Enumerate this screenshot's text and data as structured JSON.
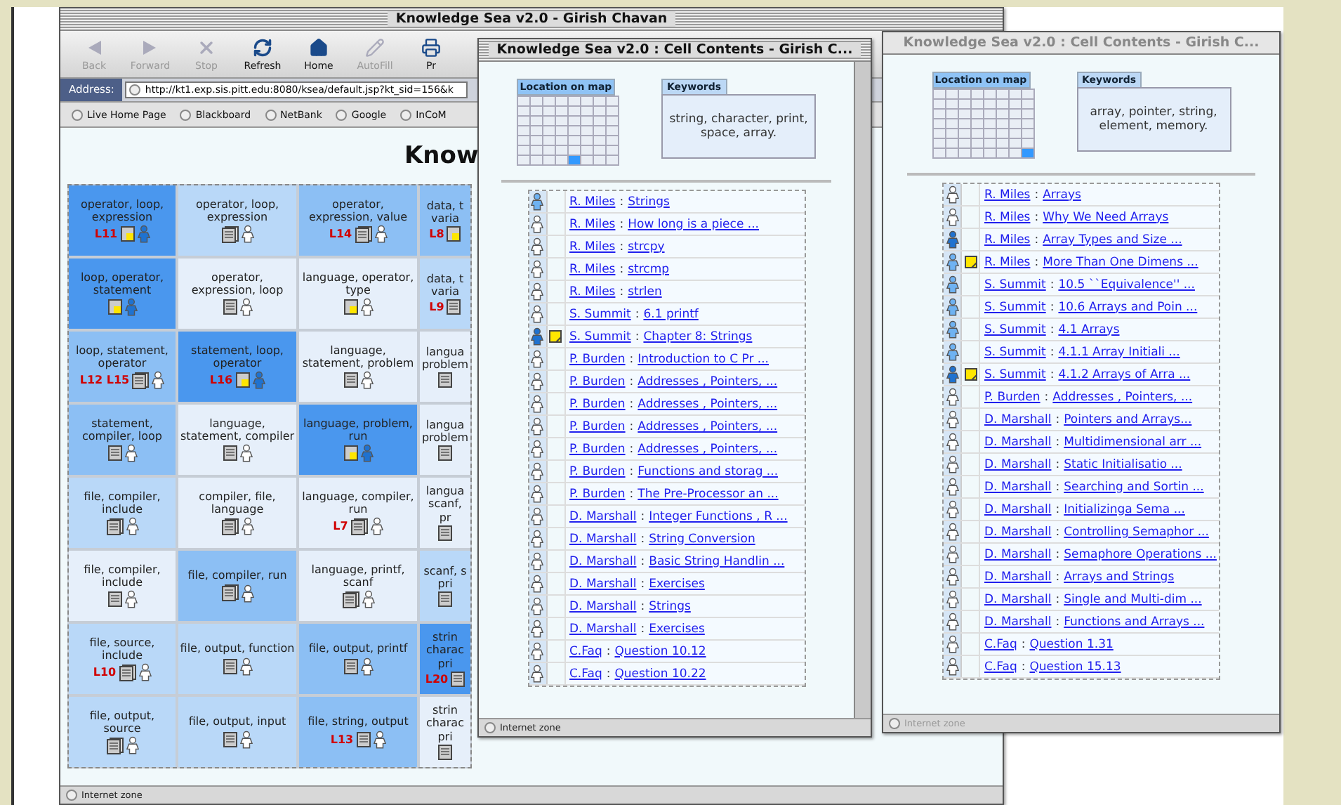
{
  "browser": {
    "title": "Knowledge Sea v2.0 - Girish Chavan",
    "toolbar": [
      {
        "label": "Back",
        "kind": "back",
        "disabled": true
      },
      {
        "label": "Forward",
        "kind": "forward",
        "disabled": true
      },
      {
        "label": "Stop",
        "kind": "stop",
        "disabled": true
      },
      {
        "label": "Refresh",
        "kind": "refresh",
        "disabled": false
      },
      {
        "label": "Home",
        "kind": "home",
        "disabled": false
      },
      {
        "label": "AutoFill",
        "kind": "autofill",
        "disabled": true
      },
      {
        "label": "Pr",
        "kind": "print",
        "disabled": false
      }
    ],
    "address_label": "Address:",
    "url": "http://kt1.exp.sis.pitt.edu:8080/ksea/default.jsp?kt_sid=156&k",
    "favorites": [
      "Live Home Page",
      "Blackboard",
      "NetBank",
      "Google",
      "InCoM"
    ],
    "heading": "Know",
    "grid": [
      [
        {
          "keywords": "operator, loop, expression",
          "labels": [
            "L11"
          ],
          "kind": "note",
          "filled": true,
          "color": "#4a97ee"
        },
        {
          "keywords": "operator, loop, expression",
          "kind": "docs",
          "filled": false,
          "color": "#b9d8f8"
        },
        {
          "keywords": "operator, expression, value",
          "labels": [
            "L14"
          ],
          "kind": "docs",
          "filled": false,
          "color": "#8cbff4"
        },
        {
          "keywords": "data, t varia",
          "labels": [
            "L8"
          ],
          "kind": "note",
          "color": "#8cbff4"
        }
      ],
      [
        {
          "keywords": "loop, operator, statement",
          "kind": "note",
          "filled": true,
          "color": "#4a97ee"
        },
        {
          "keywords": "operator, expression, loop",
          "kind": "doc",
          "filled": false,
          "color": "#e6effa"
        },
        {
          "keywords": "language, operator, type",
          "kind": "note",
          "filled": false,
          "color": "#e6effa"
        },
        {
          "keywords": "data, t varia",
          "labels": [
            "L9"
          ],
          "kind": "doc",
          "color": "#b9d8f8"
        }
      ],
      [
        {
          "keywords": "loop, statement, operator",
          "labels": [
            "L12",
            "L15"
          ],
          "kind": "docs",
          "filled": false,
          "color": "#8cbff4"
        },
        {
          "keywords": "statement, loop, operator",
          "labels": [
            "L16"
          ],
          "kind": "note",
          "filled": true,
          "color": "#4a97ee"
        },
        {
          "keywords": "language, statement, problem",
          "kind": "doc",
          "filled": false,
          "color": "#e6effa"
        },
        {
          "keywords": "langua problem",
          "kind": "doc",
          "color": "#e6effa"
        }
      ],
      [
        {
          "keywords": "statement, compiler, loop",
          "kind": "doc",
          "filled": false,
          "color": "#8cbff4"
        },
        {
          "keywords": "language, statement, compiler",
          "kind": "doc",
          "filled": false,
          "color": "#e6effa"
        },
        {
          "keywords": "language, problem, run",
          "kind": "note",
          "filled": true,
          "color": "#4a97ee"
        },
        {
          "keywords": "langua problem",
          "kind": "doc",
          "color": "#e6effa"
        }
      ],
      [
        {
          "keywords": "file, compiler, include",
          "kind": "docs",
          "filled": false,
          "color": "#b9d8f8"
        },
        {
          "keywords": "compiler, file, language",
          "kind": "docs",
          "filled": false,
          "color": "#e6effa"
        },
        {
          "keywords": "language, compiler, run",
          "labels": [
            "L7"
          ],
          "kind": "docs",
          "filled": false,
          "color": "#e6effa"
        },
        {
          "keywords": "langua scanf, pr",
          "kind": "doc",
          "color": "#e6effa"
        }
      ],
      [
        {
          "keywords": "file, compiler, include",
          "kind": "doc",
          "filled": false,
          "color": "#e6effa"
        },
        {
          "keywords": "file, compiler, run",
          "kind": "docs",
          "filled": false,
          "color": "#8cbff4"
        },
        {
          "keywords": "language, printf, scanf",
          "kind": "docs",
          "filled": false,
          "color": "#e6effa"
        },
        {
          "keywords": "scanf, s pri",
          "kind": "doc",
          "color": "#b9d8f8"
        }
      ],
      [
        {
          "keywords": "file, source, include",
          "labels": [
            "L10"
          ],
          "kind": "docs",
          "filled": false,
          "color": "#b9d8f8"
        },
        {
          "keywords": "file, output, function",
          "kind": "doc",
          "filled": false,
          "color": "#b9d8f8"
        },
        {
          "keywords": "file, output, printf",
          "kind": "doc",
          "filled": false,
          "color": "#8cbff4"
        },
        {
          "keywords": "strin charac pri",
          "labels": [
            "L20"
          ],
          "kind": "doc",
          "color": "#4a97ee"
        }
      ],
      [
        {
          "keywords": "file, output, source",
          "kind": "docs",
          "filled": false,
          "color": "#b9d8f8"
        },
        {
          "keywords": "file, output, input",
          "kind": "doc",
          "filled": false,
          "color": "#b9d8f8"
        },
        {
          "keywords": "file, string, output",
          "labels": [
            "L13"
          ],
          "kind": "doc",
          "filled": false,
          "color": "#8cbff4"
        },
        {
          "keywords": "strin charac pri",
          "kind": "doc",
          "color": "#e6effa"
        }
      ]
    ],
    "status": "Internet zone"
  },
  "windows": [
    {
      "title": "Knowledge Sea v2.0 : Cell Contents - Girish C...",
      "active": true,
      "location_label": "Location on map",
      "keywords_label": "Keywords",
      "keywords": "string, character, print, space, array.",
      "map_rows": [
        [
          false,
          false,
          false,
          false,
          false,
          false,
          false,
          false
        ],
        [
          false,
          false,
          false,
          false,
          false,
          false,
          false,
          false
        ],
        [
          false,
          false,
          false,
          false,
          false,
          false,
          false,
          false
        ],
        [
          false,
          false,
          false,
          false,
          false,
          false,
          false,
          false
        ],
        [
          false,
          false,
          false,
          false,
          false,
          false,
          false,
          false
        ],
        [
          false,
          false,
          false,
          false,
          false,
          false,
          false,
          false
        ],
        [
          false,
          false,
          false,
          false,
          true,
          false,
          false,
          false
        ]
      ],
      "items": [
        {
          "color": "#6eb2f2",
          "note": false,
          "author": "R. Miles",
          "sep": ":",
          "title": "Strings"
        },
        {
          "color": "#ffffff",
          "note": false,
          "author": "R. Miles",
          "sep": ":",
          "title": "How long is a piece ..."
        },
        {
          "color": "#ffffff",
          "note": false,
          "author": "R. Miles",
          "sep": ":",
          "title": "strcpy"
        },
        {
          "color": "#ffffff",
          "note": false,
          "author": "R. Miles",
          "sep": ":",
          "title": "strcmp"
        },
        {
          "color": "#ffffff",
          "note": false,
          "author": "R. Miles",
          "sep": ":",
          "title": "strlen"
        },
        {
          "color": "#ffffff",
          "note": false,
          "author": "S. Summit",
          "sep": ":",
          "title": "6.1 printf"
        },
        {
          "color": "#1f72d0",
          "note": true,
          "author": "S. Summit",
          "sep": ":",
          "title": "Chapter 8: Strings"
        },
        {
          "color": "#ffffff",
          "note": false,
          "author": "P. Burden",
          "sep": ":",
          "title": "Introduction to C Pr ..."
        },
        {
          "color": "#ffffff",
          "note": false,
          "author": "P. Burden",
          "sep": ":",
          "title": "Addresses , Pointers, ..."
        },
        {
          "color": "#ffffff",
          "note": false,
          "author": "P. Burden",
          "sep": ":",
          "title": "Addresses , Pointers, ..."
        },
        {
          "color": "#ffffff",
          "note": false,
          "author": "P. Burden",
          "sep": ":",
          "title": "Addresses , Pointers, ..."
        },
        {
          "color": "#ffffff",
          "note": false,
          "author": "P. Burden",
          "sep": ":",
          "title": "Addresses , Pointers, ..."
        },
        {
          "color": "#ffffff",
          "note": false,
          "author": "P. Burden",
          "sep": ":",
          "title": "Functions and storag ..."
        },
        {
          "color": "#ffffff",
          "note": false,
          "author": "P. Burden",
          "sep": ":",
          "title": "The Pre-Processor an ..."
        },
        {
          "color": "#ffffff",
          "note": false,
          "author": "D. Marshall",
          "sep": ":",
          "title": "Integer Functions , R ..."
        },
        {
          "color": "#ffffff",
          "note": false,
          "author": "D. Marshall",
          "sep": ":",
          "title": "String Conversion"
        },
        {
          "color": "#ffffff",
          "note": false,
          "author": "D. Marshall",
          "sep": ":",
          "title": "Basic String Handlin ..."
        },
        {
          "color": "#ffffff",
          "note": false,
          "author": "D. Marshall",
          "sep": ":",
          "title": "Exercises"
        },
        {
          "color": "#ffffff",
          "note": false,
          "author": "D. Marshall",
          "sep": ":",
          "title": "Strings"
        },
        {
          "color": "#ffffff",
          "note": false,
          "author": "D. Marshall",
          "sep": ":",
          "title": "Exercises"
        },
        {
          "color": "#ffffff",
          "note": false,
          "author": "C.Faq",
          "sep": ":",
          "title": "Question 10.12"
        },
        {
          "color": "#ffffff",
          "note": false,
          "author": "C.Faq",
          "sep": ":",
          "title": "Question 10.22"
        }
      ],
      "status": "Internet zone"
    },
    {
      "title": "Knowledge Sea v2.0 : Cell Contents - Girish C...",
      "active": false,
      "location_label": "Location on map",
      "keywords_label": "Keywords",
      "keywords": "array, pointer, string, element, memory.",
      "map_rows": [
        [
          false,
          false,
          false,
          false,
          false,
          false,
          false,
          false
        ],
        [
          false,
          false,
          false,
          false,
          false,
          false,
          false,
          false
        ],
        [
          false,
          false,
          false,
          false,
          false,
          false,
          false,
          false
        ],
        [
          false,
          false,
          false,
          false,
          false,
          false,
          false,
          false
        ],
        [
          false,
          false,
          false,
          false,
          false,
          false,
          false,
          false
        ],
        [
          false,
          false,
          false,
          false,
          false,
          false,
          false,
          false
        ],
        [
          false,
          false,
          false,
          false,
          false,
          false,
          false,
          true
        ]
      ],
      "items": [
        {
          "color": "#ffffff",
          "note": false,
          "author": "R. Miles",
          "sep": ":",
          "title": "Arrays"
        },
        {
          "color": "#ffffff",
          "note": false,
          "author": "R. Miles",
          "sep": ":",
          "title": "Why We Need Arrays"
        },
        {
          "color": "#1f72d0",
          "note": false,
          "author": "R. Miles",
          "sep": ":",
          "title": "Array Types and Size ..."
        },
        {
          "color": "#6eb2f2",
          "note": true,
          "author": "R. Miles",
          "sep": ":",
          "title": "More Than One Dimens ..."
        },
        {
          "color": "#6eb2f2",
          "note": false,
          "author": "S. Summit",
          "sep": ":",
          "title": "10.5 ``Equivalence'' ..."
        },
        {
          "color": "#6eb2f2",
          "note": false,
          "author": "S. Summit",
          "sep": ":",
          "title": "10.6 Arrays and Poin ..."
        },
        {
          "color": "#6eb2f2",
          "note": false,
          "author": "S. Summit",
          "sep": ":",
          "title": "4.1 Arrays"
        },
        {
          "color": "#6eb2f2",
          "note": false,
          "author": "S. Summit",
          "sep": ":",
          "title": "4.1.1 Array Initiali ..."
        },
        {
          "color": "#1f72d0",
          "note": true,
          "author": "S. Summit",
          "sep": ":",
          "title": "4.1.2 Arrays of Arra ..."
        },
        {
          "color": "#ffffff",
          "note": false,
          "author": "P. Burden",
          "sep": ":",
          "title": "Addresses , Pointers, ..."
        },
        {
          "color": "#ffffff",
          "note": false,
          "author": "D. Marshall",
          "sep": ":",
          "title": "Pointers and Arrays..."
        },
        {
          "color": "#ffffff",
          "note": false,
          "author": "D. Marshall",
          "sep": ":",
          "title": "Multidimensional arr ..."
        },
        {
          "color": "#ffffff",
          "note": false,
          "author": "D. Marshall",
          "sep": ":",
          "title": "Static Initialisatio ..."
        },
        {
          "color": "#ffffff",
          "note": false,
          "author": "D. Marshall",
          "sep": ":",
          "title": "Searching and Sortin ..."
        },
        {
          "color": "#ffffff",
          "note": false,
          "author": "D. Marshall",
          "sep": ":",
          "title": "Initializinga Sema ..."
        },
        {
          "color": "#ffffff",
          "note": false,
          "author": "D. Marshall",
          "sep": ":",
          "title": "Controlling Semaphor ..."
        },
        {
          "color": "#ffffff",
          "note": false,
          "author": "D. Marshall",
          "sep": ":",
          "title": "Semaphore Operations ..."
        },
        {
          "color": "#ffffff",
          "note": false,
          "author": "D. Marshall",
          "sep": ":",
          "title": "Arrays and Strings"
        },
        {
          "color": "#ffffff",
          "note": false,
          "author": "D. Marshall",
          "sep": ":",
          "title": "Single and Multi-dim ..."
        },
        {
          "color": "#ffffff",
          "note": false,
          "author": "D. Marshall",
          "sep": ":",
          "title": "Functions and Arrays ..."
        },
        {
          "color": "#ffffff",
          "note": false,
          "author": "C.Faq",
          "sep": ":",
          "title": "Question 1.31"
        },
        {
          "color": "#ffffff",
          "note": false,
          "author": "C.Faq",
          "sep": ":",
          "title": "Question 15.13"
        }
      ],
      "status": "Internet zone"
    }
  ]
}
